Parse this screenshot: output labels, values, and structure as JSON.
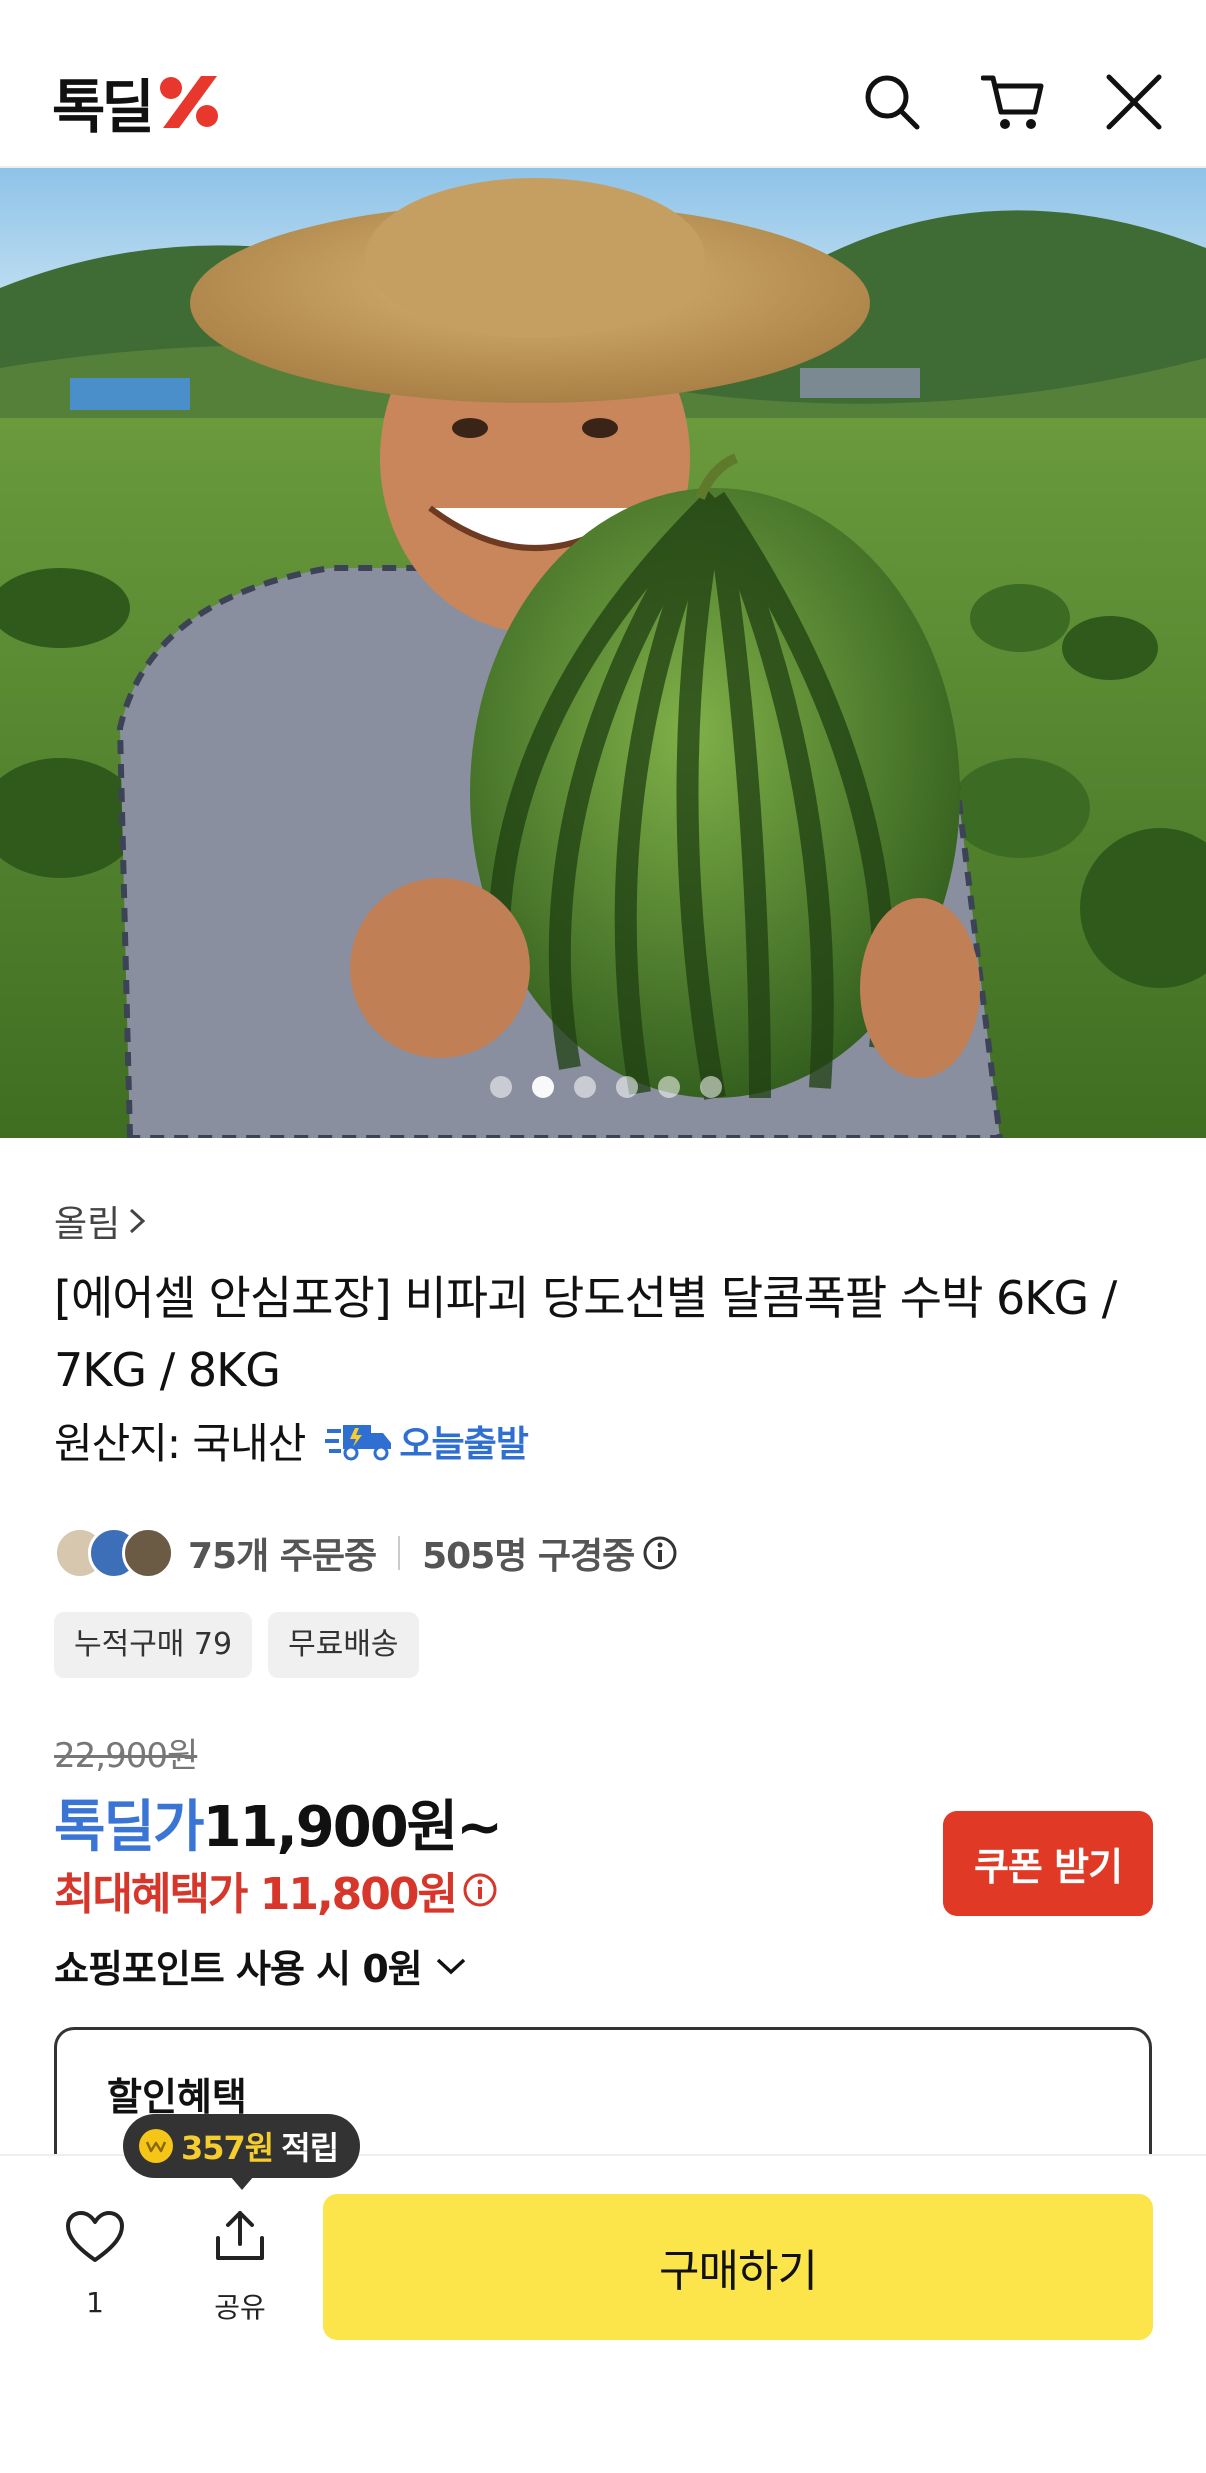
{
  "header": {
    "logo_text": "톡딜",
    "icons": [
      "search-icon",
      "cart-icon",
      "close-icon"
    ]
  },
  "hero": {
    "image_count": 6,
    "active_index": 1
  },
  "product": {
    "brand": "올림",
    "title": "[에어셀 안심포장] 비파괴 당도선별 달콤폭팔 수박 6KG / 7KG / 8KG",
    "origin": "원산지: 국내산",
    "shipping_badge": "오늘출발",
    "ordering": "75개 주문중",
    "viewing": "505명 구경중",
    "tags": [
      "누적구매 79",
      "무료배송"
    ]
  },
  "price": {
    "original": "22,900원",
    "deal_label": "톡딜가",
    "deal_price": "11,900원~",
    "max_benefit": "최대혜택가 11,800원",
    "coupon_button": "쿠폰 받기",
    "points_text": "쇼핑포인트 사용 시 0원"
  },
  "discount": {
    "title": "할인혜택"
  },
  "bottom": {
    "tooltip_amount": "357원",
    "tooltip_suffix": "적립",
    "like_count": "1",
    "share_label": "공유",
    "buy_button": "구매하기"
  },
  "colors": {
    "deal_blue": "#3a75d6",
    "benefit_red": "#d7372a",
    "coupon_red": "#e03a26",
    "buy_yellow": "#fce54b",
    "logo_red": "#e8372c"
  }
}
